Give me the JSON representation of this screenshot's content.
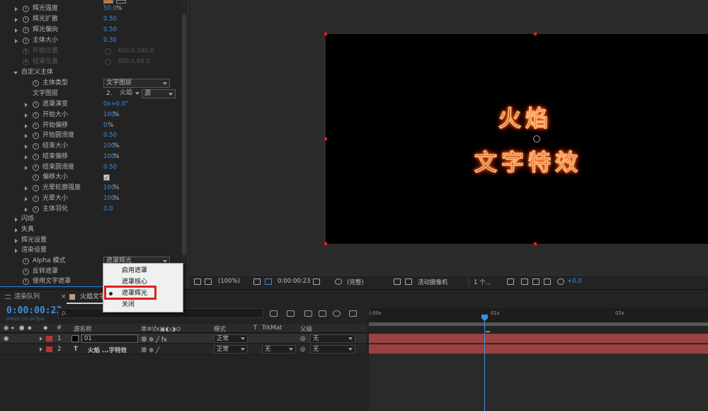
{
  "effect_controls": {
    "rows": [
      {
        "label": "辉光强度",
        "value": "50.0",
        "unit": "%"
      },
      {
        "label": "辉光扩散",
        "value": "0.50"
      },
      {
        "label": "辉光偏向",
        "value": "0.50"
      },
      {
        "label": "主体大小",
        "value": "0.30"
      },
      {
        "label": "开始位置",
        "value": "400.0,340.0"
      },
      {
        "label": "结束位置",
        "value": "400.0,60.0"
      }
    ],
    "custom_group": "自定义主体",
    "body_type_label": "主体类型",
    "body_type_value": "文字图层",
    "text_layer_label": "文字图层",
    "text_layer_num": "2.",
    "text_layer_name": "火焰",
    "text_layer_source": "源",
    "sub_rows": [
      {
        "label": "遮罩演变",
        "value": "0x+0.0°"
      },
      {
        "label": "开始大小",
        "value": "100",
        "unit": "%"
      },
      {
        "label": "开始偏移",
        "value": "0",
        "unit": "%"
      },
      {
        "label": "开始圆滑度",
        "value": "0.50"
      },
      {
        "label": "结束大小",
        "value": "100",
        "unit": "%"
      },
      {
        "label": "结束偏移",
        "value": "100",
        "unit": "%"
      },
      {
        "label": "结束圆滑度",
        "value": "0.50"
      },
      {
        "label": "偏移大小",
        "value": ""
      },
      {
        "label": "光晕轮廓强度",
        "value": "100",
        "unit": "%"
      },
      {
        "label": "光晕大小",
        "value": "100",
        "unit": "%"
      },
      {
        "label": "主体羽化",
        "value": "0.0"
      }
    ],
    "groups": [
      "闪烁",
      "失真",
      "辉光设置",
      "渲染设置"
    ],
    "alpha_label": "Alpha 模式",
    "alpha_value": "遮罩辉光",
    "invert_label": "反转遮罩",
    "use_text_mask_label": "使用文字遮罩"
  },
  "context_menu": {
    "items": [
      "启用遮罩",
      "遮罩核心",
      "遮罩辉光",
      "关闭"
    ],
    "selected_index": 2
  },
  "composition": {
    "line1": "火焰",
    "line2": "文字特效"
  },
  "viewer_toolbar": {
    "zoom": "(100%)",
    "timecode": "0:00:00:23",
    "quality": "(完整)",
    "camera": "活动摄像机",
    "views": "1 个...",
    "exposure": "+0.0"
  },
  "timeline": {
    "tab_render": "渲染队列",
    "tab_comp": "火焰文字",
    "timecode": "0:00:00:23",
    "fps": "00023 (25.00 fps)",
    "search_placeholder": "ρ.",
    "headers": {
      "num": "#",
      "source": "源名称",
      "switches": "单✲\\fx▣◐◑⊙",
      "mode": "模式",
      "t": "T",
      "trkmat": "TrkMat",
      "parent": "父级"
    },
    "layers": [
      {
        "num": "1",
        "type": "",
        "name": "01",
        "mode": "正常",
        "trkmat": "",
        "parent": "无"
      },
      {
        "num": "2",
        "type": "T",
        "name": "火焰 ...字特效",
        "mode": "正常",
        "trkmat": "无",
        "parent": "无"
      }
    ],
    "ruler": [
      "):00s",
      "01s",
      "02s"
    ]
  },
  "colors": {
    "accent": "#3d8fe0",
    "fire": "#ff6b1a",
    "track": "#b04545",
    "highlight": "#e02020"
  }
}
